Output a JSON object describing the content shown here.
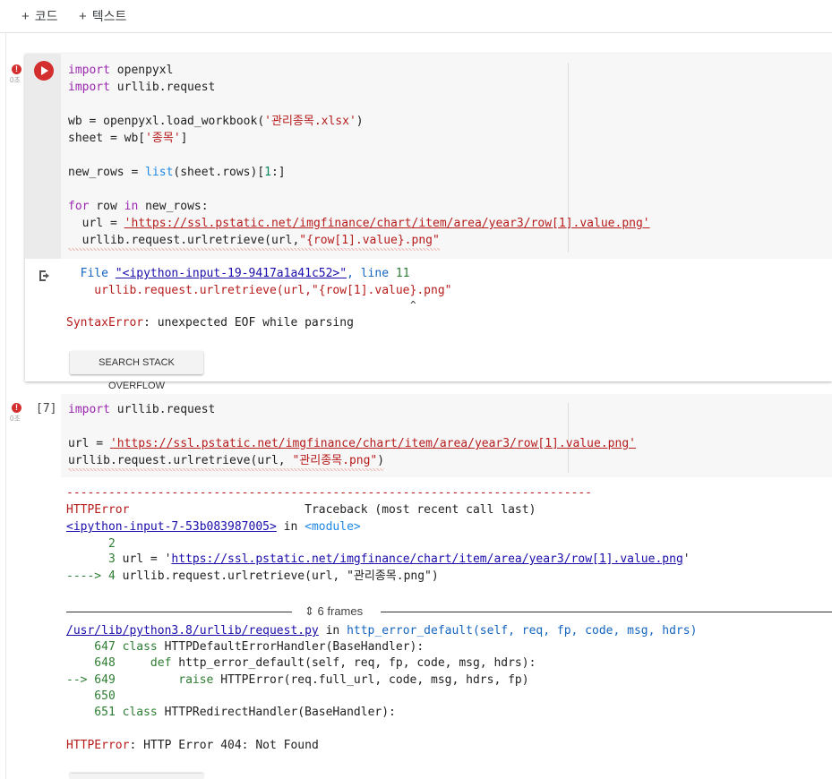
{
  "toolbar": {
    "code_label": "코드",
    "text_label": "텍스트"
  },
  "cell1": {
    "time": "0초",
    "code": {
      "l1_kw": "import",
      "l1_rest": " openpyxl",
      "l2_kw": "import",
      "l2_rest": " urllib.request",
      "l3_a": "wb = openpyxl.load_workbook(",
      "l3_str": "'관리종목.xlsx'",
      "l3_b": ")",
      "l4_a": "sheet = wb[",
      "l4_str": "'종목'",
      "l4_b": "]",
      "l5_a": "new_rows = ",
      "l5_fn": "list",
      "l5_b": "(sheet.rows)[",
      "l5_num": "1",
      "l5_c": ":]",
      "l6_kw1": "for",
      "l6_a": " row ",
      "l6_kw2": "in",
      "l6_b": " new_rows:",
      "l7_a": "  url = ",
      "l7_str": "'https://ssl.pstatic.net/imgfinance/chart/item/area/year3/row[1].value.png'",
      "l8_a": "  urllib.request.urlretrieve(url,",
      "l8_str": "\"{row[1].value}.png\""
    },
    "output": {
      "file_label": "  File ",
      "file_link": "\"<ipython-input-19-9417a1a41c52>\"",
      "line_label": ", line ",
      "line_num": "11",
      "code_echo": "    urllib.request.urlretrieve(url,\"{row[1].value}.png\"",
      "caret": "^",
      "error_type": "SyntaxError",
      "error_msg": ": unexpected EOF while parsing"
    },
    "so_button": "SEARCH STACK OVERFLOW"
  },
  "cell2": {
    "time": "0초",
    "exec_count": "[7]",
    "code": {
      "l1_kw": "import",
      "l1_rest": " urllib.request",
      "l2_a": "url = ",
      "l2_str": "'https://ssl.pstatic.net/imgfinance/chart/item/area/year3/row[1].value.png'",
      "l3_a": "urllib.request.urlretrieve(url, ",
      "l3_str": "\"관리종목.png\"",
      "l3_b": ")"
    },
    "output": {
      "dashes": "---------------------------------------------------------------------------",
      "err_name": "HTTPError",
      "traceback": "                         Traceback (most recent call last)",
      "input_link": "<ipython-input-7-53b083987005>",
      "in_word": " in ",
      "module": "<module>",
      "ln2": "      2",
      "ln3_num": "      3",
      "ln3_a": " url = '",
      "ln3_link": "https://ssl.pstatic.net/imgfinance/chart/item/area/year3/row[1].value.png",
      "ln3_b": "'",
      "ln4_arrow": "----> 4",
      "ln4_a": " urllib.request.urlretrieve(url, \"관리종목.png\")",
      "frames": "6 frames",
      "path_link": "/usr/lib/python3.8/urllib/request.py",
      "path_in": " in ",
      "func": "http_error_default(self, req, fp, code, msg, hdrs)",
      "f647_num": "    647",
      "f647_kw": " class",
      "f647_rest": " HTTPDefaultErrorHandler(BaseHandler):",
      "f648_num": "    648",
      "f648_kw": "     def",
      "f648_rest": " http_error_default(self, req, fp, code, msg, hdrs):",
      "f649_num": "--> 649",
      "f649_kw": "         raise",
      "f649_rest": " HTTPError(req.full_url, code, msg, hdrs, fp)",
      "f650_num": "    650",
      "f651_num": "    651",
      "f651_kw": " class",
      "f651_rest": " HTTPRedirectHandler(BaseHandler):",
      "final_type": "HTTPError",
      "final_msg": ": HTTP Error 404: Not Found"
    }
  }
}
